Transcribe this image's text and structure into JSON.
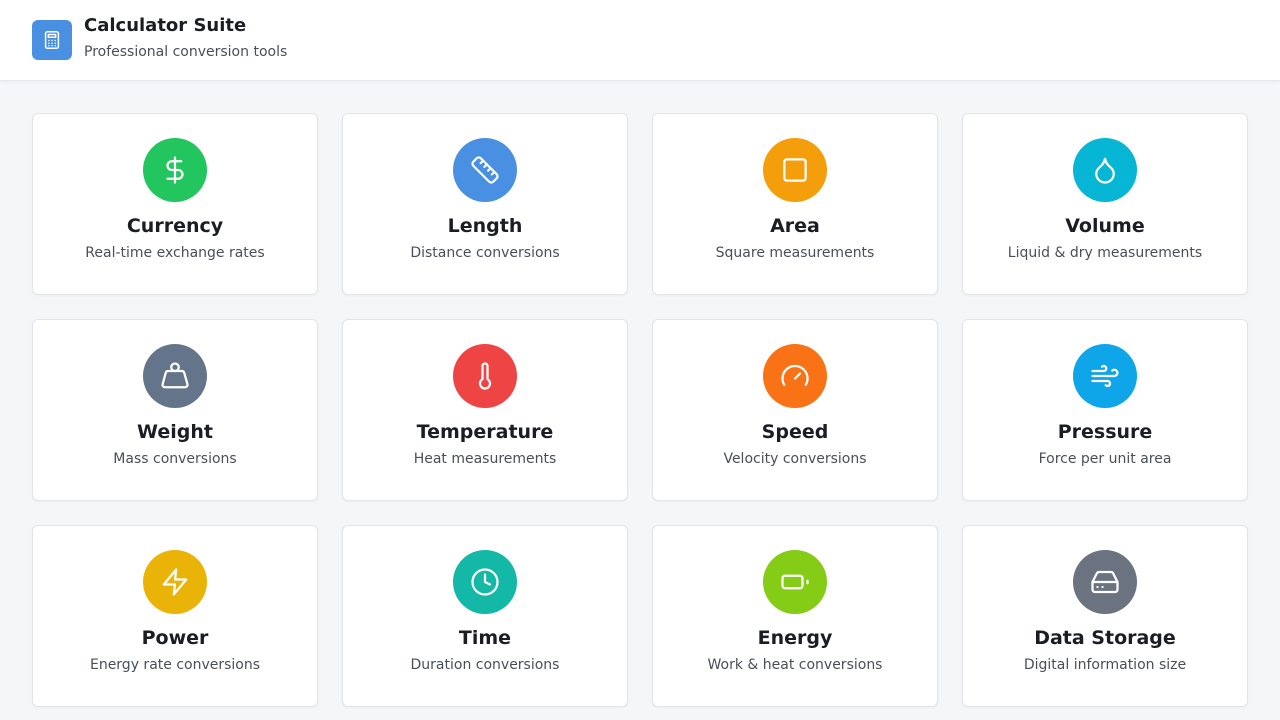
{
  "header": {
    "title": "Calculator Suite",
    "subtitle": "Professional conversion tools",
    "logo_color": "#4a90e2",
    "logo_icon": "calculator-icon"
  },
  "cards": [
    {
      "title": "Currency",
      "description": "Real-time exchange rates",
      "color": "#22c55e",
      "icon": "dollar-icon"
    },
    {
      "title": "Length",
      "description": "Distance conversions",
      "color": "#4a90e2",
      "icon": "ruler-icon"
    },
    {
      "title": "Area",
      "description": "Square measurements",
      "color": "#f59e0b",
      "icon": "square-icon"
    },
    {
      "title": "Volume",
      "description": "Liquid & dry measurements",
      "color": "#06b6d4",
      "icon": "droplet-icon"
    },
    {
      "title": "Weight",
      "description": "Mass conversions",
      "color": "#64748b",
      "icon": "weight-icon"
    },
    {
      "title": "Temperature",
      "description": "Heat measurements",
      "color": "#ef4444",
      "icon": "thermometer-icon"
    },
    {
      "title": "Speed",
      "description": "Velocity conversions",
      "color": "#f97316",
      "icon": "gauge-icon"
    },
    {
      "title": "Pressure",
      "description": "Force per unit area",
      "color": "#0ea5e9",
      "icon": "wind-icon"
    },
    {
      "title": "Power",
      "description": "Energy rate conversions",
      "color": "#eab308",
      "icon": "lightning-icon"
    },
    {
      "title": "Time",
      "description": "Duration conversions",
      "color": "#14b8a6",
      "icon": "clock-icon"
    },
    {
      "title": "Energy",
      "description": "Work & heat conversions",
      "color": "#84cc16",
      "icon": "battery-icon"
    },
    {
      "title": "Data Storage",
      "description": "Digital information size",
      "color": "#6b7280",
      "icon": "hard-drive-icon"
    }
  ]
}
